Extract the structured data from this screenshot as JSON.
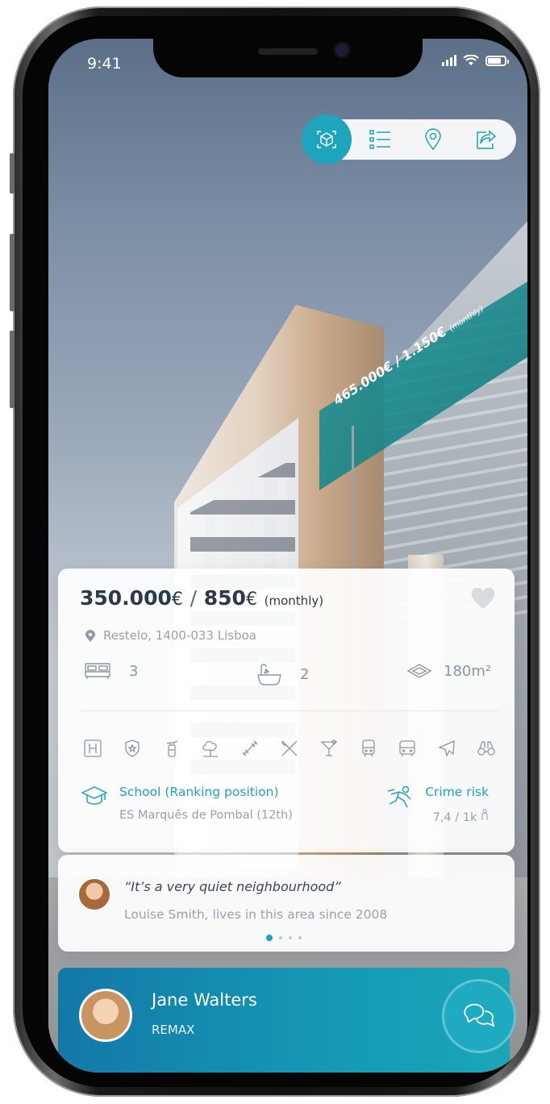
{
  "status_bar": {
    "time": "9:41"
  },
  "toolbar": {
    "items": [
      {
        "icon": "cube-view-icon",
        "active": true
      },
      {
        "icon": "list-icon",
        "active": false
      },
      {
        "icon": "location-pin-icon",
        "active": false
      },
      {
        "icon": "share-icon",
        "active": false
      }
    ],
    "accent_color": "#1ea4bd"
  },
  "scene": {
    "banner_price": "465.000€ / 1.150€",
    "banner_suffix": "(monthly)"
  },
  "listing": {
    "price_sale": "350.000",
    "price_sale_unit": "€",
    "separator": "/",
    "price_rent": "850",
    "price_rent_unit": "€",
    "price_rent_period": "(monthly)",
    "address": "Restelo, 1400-033 Lisboa",
    "bedrooms": "3",
    "bathrooms": "2",
    "area": "180m²",
    "amenities": [
      "hospital-icon",
      "police-icon",
      "fire-extinguisher-icon",
      "park-icon",
      "gym-icon",
      "restaurant-icon",
      "bar-icon",
      "train-icon",
      "bus-icon",
      "airport-icon",
      "binoculars-icon"
    ],
    "school": {
      "title": "School (Ranking position)",
      "value": "ES Marquês de Pombal (12th)"
    },
    "crime": {
      "title": "Crime risk",
      "value": "7,4 / 1k"
    }
  },
  "testimonial": {
    "quote": "“It’s a very quiet neighbourhood”",
    "author": "Louise Smith, lives in this area since 2008",
    "pages": 4,
    "current_page": 1
  },
  "agent": {
    "name": "Jane Walters",
    "company": "REMAX"
  }
}
